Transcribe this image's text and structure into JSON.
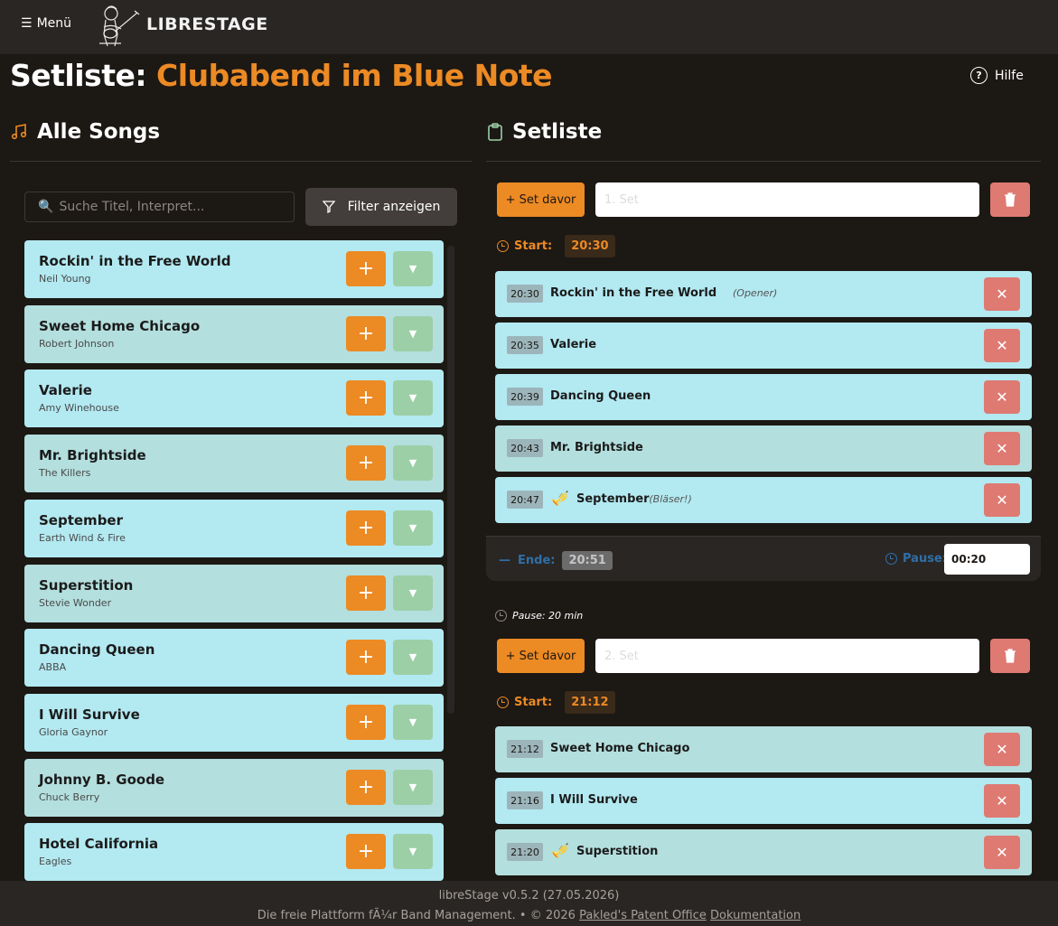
{
  "app": {
    "menu_label": "Menü",
    "brand": "LIBRESTAGE",
    "help_label": "Hilfe"
  },
  "page": {
    "title_label": "Setliste:",
    "title_name": "Clubabend im Blue Note"
  },
  "songs_panel": {
    "heading": "Alle Songs",
    "search_placeholder": "Suche Titel, Interpret...",
    "filter_label": "Filter anzeigen",
    "songs": [
      {
        "title": "Rockin' in the Free World",
        "artist": "Neil Young",
        "bg": "#b3e9f1"
      },
      {
        "title": "Sweet Home Chicago",
        "artist": "Robert Johnson",
        "bg": "#b3dfde"
      },
      {
        "title": "Valerie",
        "artist": "Amy Winehouse",
        "bg": "#b3e9f1"
      },
      {
        "title": "Mr. Brightside",
        "artist": "The Killers",
        "bg": "#b3dfde"
      },
      {
        "title": "September",
        "artist": "Earth Wind & Fire",
        "bg": "#b3e9f1"
      },
      {
        "title": "Superstition",
        "artist": "Stevie Wonder",
        "bg": "#b3dfde"
      },
      {
        "title": "Dancing Queen",
        "artist": "ABBA",
        "bg": "#b3e9f1"
      },
      {
        "title": "I Will Survive",
        "artist": "Gloria Gaynor",
        "bg": "#b3e9f1"
      },
      {
        "title": "Johnny B. Goode",
        "artist": "Chuck Berry",
        "bg": "#b3dfde"
      },
      {
        "title": "Hotel California",
        "artist": "Eagles",
        "bg": "#b3e9f1"
      }
    ]
  },
  "setlist_panel": {
    "heading": "Setliste",
    "set_before_label": "+ Set davor",
    "start_label": "Start:",
    "end_label": "Ende:",
    "pause_label": "Pause:",
    "sets": [
      {
        "name_placeholder": "1. Set",
        "start": "20:30",
        "end": "20:51",
        "pause_value": "00:20",
        "entries": [
          {
            "time": "20:30",
            "title": "Rockin' in the Free World",
            "note": "(Opener)",
            "horn": false,
            "bg": "#b3e9f1"
          },
          {
            "time": "20:35",
            "title": "Valerie",
            "note": "",
            "horn": false,
            "bg": "#b3e9f1"
          },
          {
            "time": "20:39",
            "title": "Dancing Queen",
            "note": "",
            "horn": false,
            "bg": "#b3e9f1"
          },
          {
            "time": "20:43",
            "title": "Mr. Brightside",
            "note": "",
            "horn": false,
            "bg": "#b3dfde"
          },
          {
            "time": "20:47",
            "title": "September",
            "note": "(Bläser!)",
            "horn": true,
            "bg": "#b3e9f1"
          }
        ]
      },
      {
        "pause_note": "Pause: 20 min",
        "name_placeholder": "2. Set",
        "start": "21:12",
        "entries": [
          {
            "time": "21:12",
            "title": "Sweet Home Chicago",
            "note": "",
            "horn": false,
            "bg": "#b3dfde"
          },
          {
            "time": "21:16",
            "title": "I Will Survive",
            "note": "",
            "horn": false,
            "bg": "#b3e9f1"
          },
          {
            "time": "21:20",
            "title": "Superstition",
            "note": "",
            "horn": true,
            "bg": "#b3dfde"
          }
        ]
      }
    ]
  },
  "footer": {
    "version": "libreStage v0.5.2 (27.05.2026)",
    "tagline": "Die freie Plattform fÃ¼r Band Management. • © 2026",
    "link_org": "Pakled's Patent Office",
    "link_docs": "Dokumentation"
  },
  "colors": {
    "accent": "#ec8a24",
    "danger": "#de7a72",
    "expand": "#9ccfa6",
    "background": "#1c1814",
    "topbar": "#2a2624"
  }
}
